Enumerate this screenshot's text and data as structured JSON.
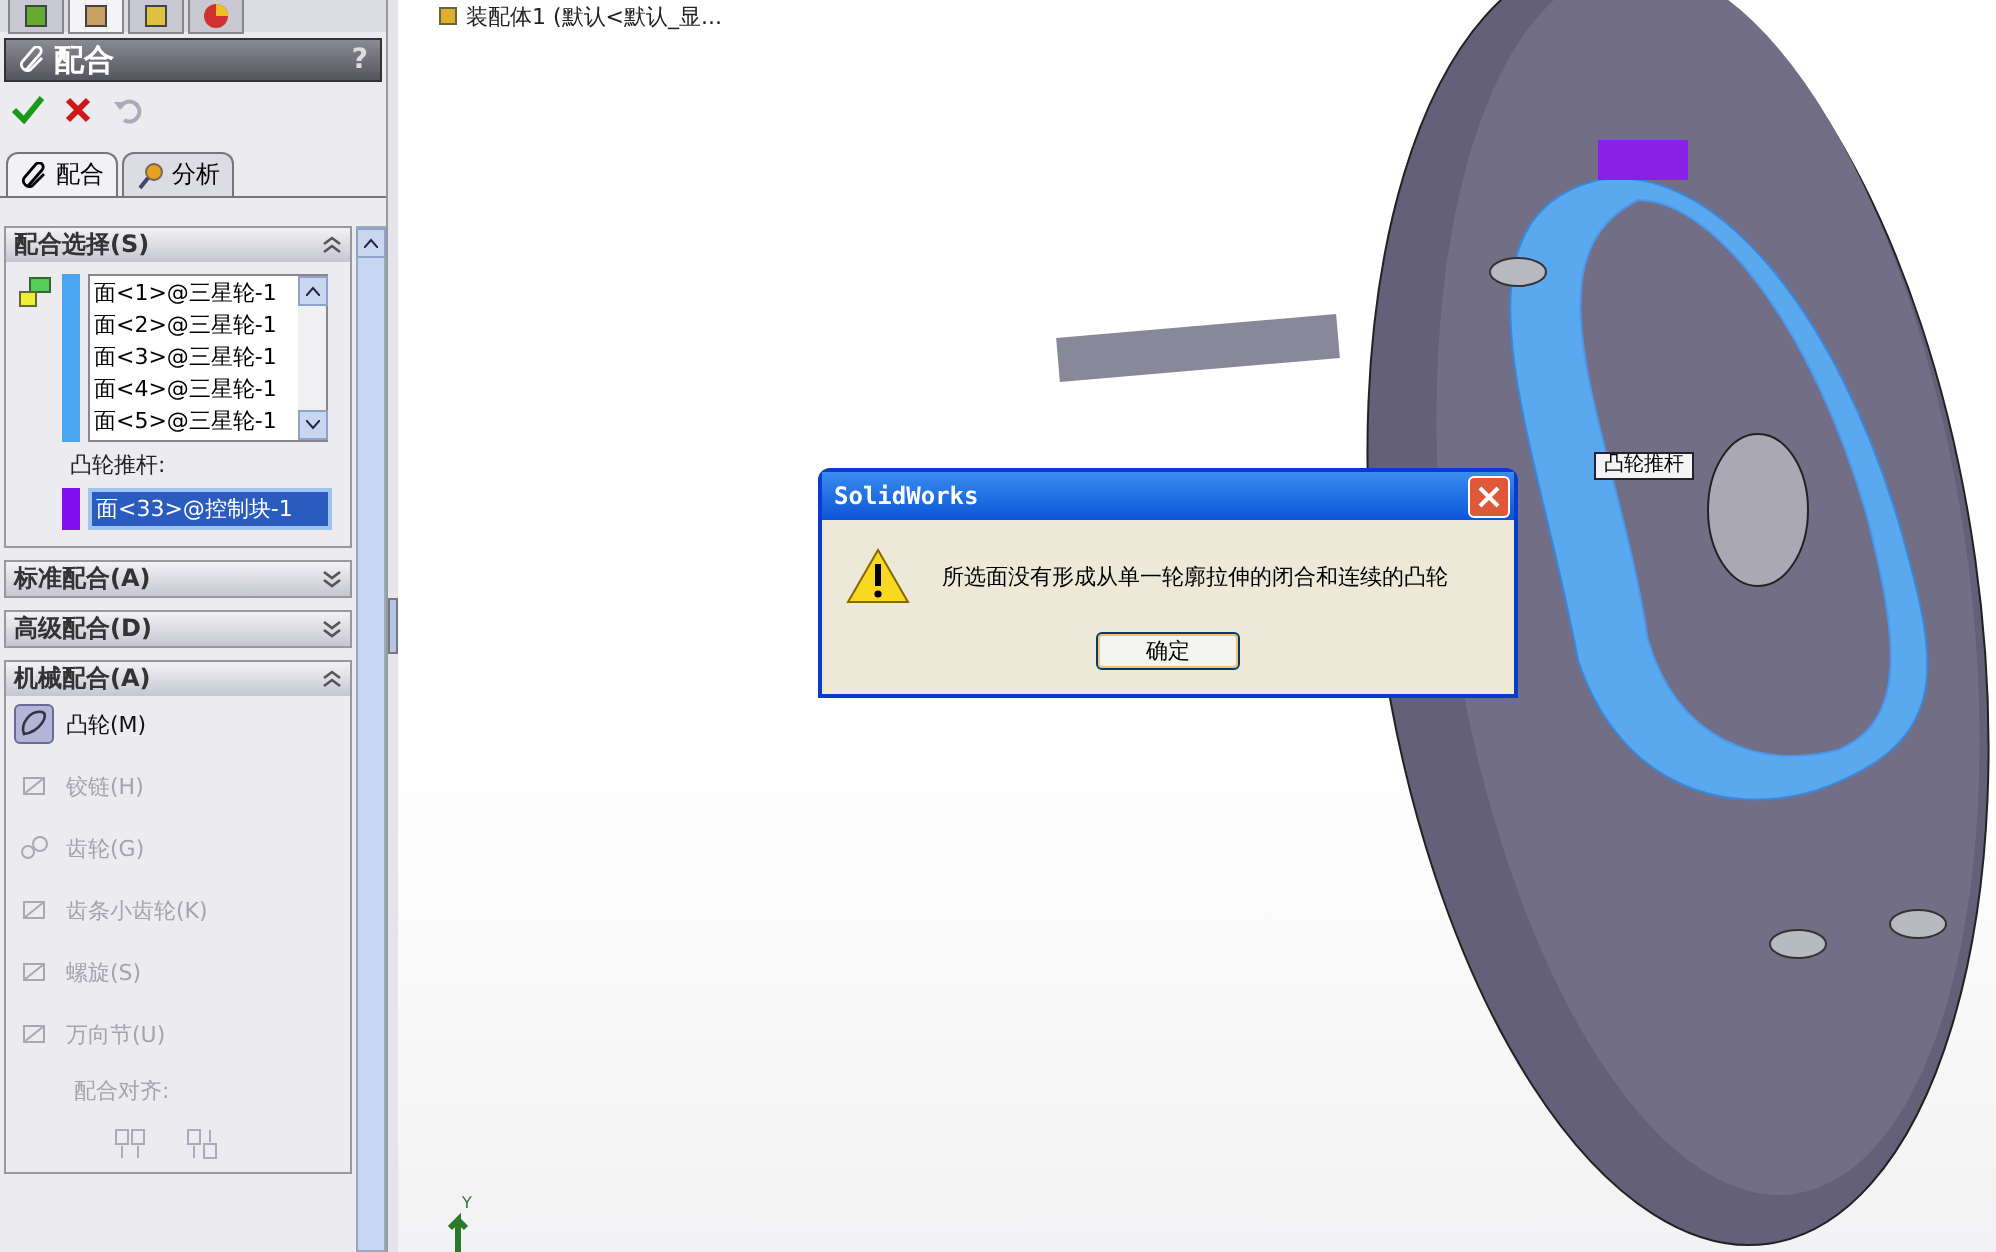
{
  "panel_tabs": [
    {
      "selected": false
    },
    {
      "selected": true
    },
    {
      "selected": false
    },
    {
      "selected": false
    }
  ],
  "property_manager": {
    "title": "配合",
    "help": "?"
  },
  "tabs": [
    {
      "label": "配合",
      "selected": true
    },
    {
      "label": "分析",
      "selected": false
    }
  ],
  "sections": [
    {
      "kind": "selection",
      "title": "配合选择(S)",
      "expanded": true,
      "faces": [
        "面<1>@三星轮-1",
        "面<2>@三星轮-1",
        "面<3>@三星轮-1",
        "面<4>@三星轮-1",
        "面<5>@三星轮-1"
      ],
      "follower_label": "凸轮推杆:",
      "follower_value": "面<33>@控制块-1"
    },
    {
      "title": "标准配合(A)",
      "expanded": false
    },
    {
      "title": "高级配合(D)",
      "expanded": false
    },
    {
      "kind": "mechanical",
      "title": "机械配合(A)",
      "expanded": true,
      "items": [
        {
          "label": "凸轮(M)",
          "selected": true,
          "disabled": false
        },
        {
          "label": "铰链(H)",
          "selected": false,
          "disabled": true
        },
        {
          "label": "齿轮(G)",
          "selected": false,
          "disabled": true
        },
        {
          "label": "齿条小齿轮(K)",
          "selected": false,
          "disabled": true
        },
        {
          "label": "螺旋(S)",
          "selected": false,
          "disabled": true
        },
        {
          "label": "万向节(U)",
          "selected": false,
          "disabled": true
        }
      ],
      "align_label": "配合对齐:"
    }
  ],
  "viewport": {
    "tree_text": "装配体1 (默认<默认_显...",
    "callout": "凸轮推杆",
    "axis_label": "Y"
  },
  "dialog": {
    "title": "SolidWorks",
    "message": "所选面没有形成从单一轮廓拉伸的闭合和连续的凸轮",
    "button": "确定"
  }
}
